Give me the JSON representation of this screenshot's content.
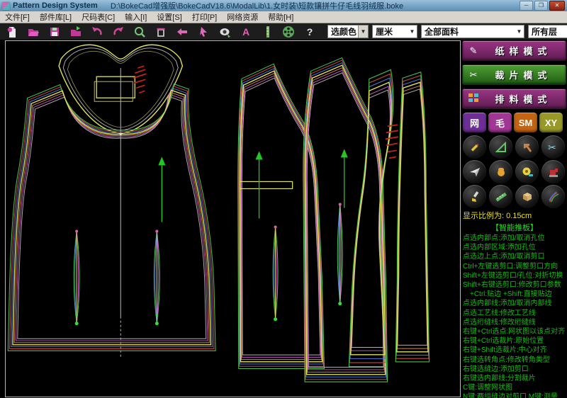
{
  "window": {
    "app_title": "Pattern Design System",
    "file_path": "D:\\BokeCad增强版\\BokeCadV18.6\\ModalLib\\1.女时装\\短款镶拼牛仔毛线羽绒服.boke",
    "controls": {
      "minimize": "─",
      "maximize": "❐",
      "close": "✕"
    }
  },
  "menu": {
    "items": [
      {
        "label": "文件[F]"
      },
      {
        "label": "部件库[L]"
      },
      {
        "label": "尺码表[C]"
      },
      {
        "label": "输入[I]"
      },
      {
        "label": "设置[S]"
      },
      {
        "label": "打印[P]"
      },
      {
        "label": "网络资源"
      },
      {
        "label": "帮助[H]"
      }
    ]
  },
  "toolbar": {
    "icons": [
      "new-document",
      "open-folder",
      "save",
      "import-folder",
      "undo",
      "redo",
      "zoom-search",
      "delete-trash",
      "move-arrow",
      "cursor-arrow",
      "view-lens",
      "text-tool",
      "ruler",
      "film-reel",
      "help"
    ],
    "text_tool_glyph": "A",
    "help_glyph": "?",
    "dropdowns": {
      "color_mode": "选颜色",
      "unit": "厘米",
      "fabric": "全部面料",
      "layer": "所有层"
    }
  },
  "sidebar": {
    "modes": [
      {
        "label": "纸样模式"
      },
      {
        "label": "裁片模式"
      },
      {
        "label": "排料模式"
      }
    ],
    "small_buttons": [
      {
        "label": "网"
      },
      {
        "label": "毛"
      },
      {
        "label": "SM"
      },
      {
        "label": "XY"
      }
    ],
    "tool_icons": [
      "pencil",
      "set-square",
      "tools",
      "scissors",
      "paper-plane",
      "hand",
      "tape-measure",
      "sewing-machine",
      "brush",
      "ruler-slant",
      "fabric",
      "threads"
    ],
    "scale_label": "显示比例为: 0.15cm",
    "smart_mode": "【智能推板】",
    "help_lines": [
      "点选内部点:添加/取消孔位",
      "点选内部区域:添加孔位",
      "点选边上点:添加/取消剪口",
      "Ctrl+左键选剪口:调整剪口方向",
      "Shift+左键选剪口/孔位:对折切换",
      "Shift+右键选剪口:修改剪口参数",
      "+Ctrl:贴边 +Shift:直接贴边",
      "点选内部线:添加/取消内部线",
      "点选工艺线:修改工艺线",
      "点选绗缝线:修改绗缝线",
      "右键+Ctrl选点:网状图以该点对齐",
      "右键+Ctrl选裁片:原始位置",
      "右键+Shift选裁片:中心对齐",
      "右键选转角点:修改转角类型",
      "右键选缝边:添加剪口",
      "右键选内部线:分割裁片",
      "C键:调整网状图",
      "N键:两组缝边对剪口  M键:测量"
    ]
  },
  "canvas": {
    "background": "#000000",
    "border": "#b9b9b9"
  }
}
